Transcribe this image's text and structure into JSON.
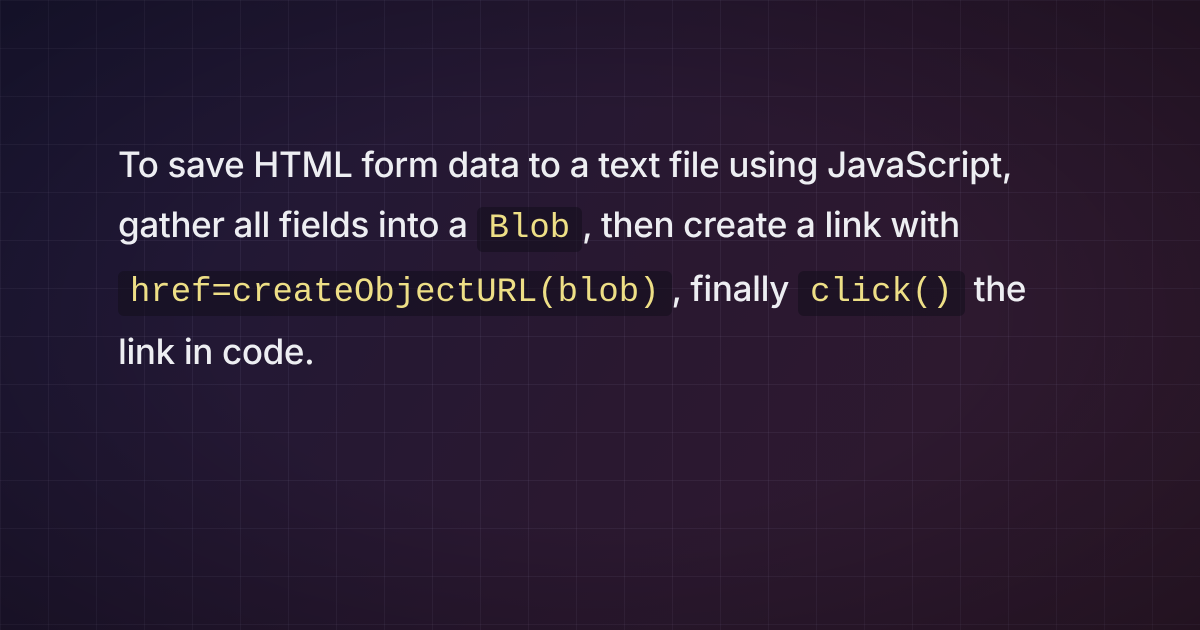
{
  "paragraph": {
    "segments": [
      {
        "type": "text",
        "value": "To save HTML form data to a text file using JavaScript, gather all fields into a "
      },
      {
        "type": "code",
        "value": "Blob"
      },
      {
        "type": "text",
        "value": ", then create a link with "
      },
      {
        "type": "code",
        "value": "href=createObjectURL(blob)"
      },
      {
        "type": "text",
        "value": ", finally "
      },
      {
        "type": "code",
        "value": "click()"
      },
      {
        "type": "text",
        "value": " the link in code."
      }
    ]
  },
  "style": {
    "grid_spacing_px": 48,
    "bg_gradient_from": "#1c1838",
    "bg_gradient_to": "#311a2e",
    "text_color": "#edeef2",
    "code_color": "#eedf86",
    "code_bg": "rgba(18,14,28,0.55)"
  }
}
